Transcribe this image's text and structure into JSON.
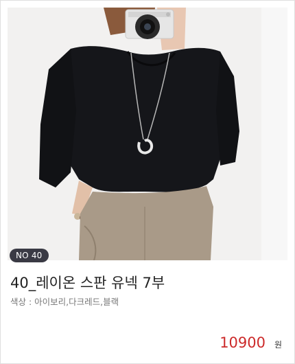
{
  "product": {
    "badge": "NO 40",
    "title": "40_레이온 스판 유넥 7부",
    "colors": "색상 : 아이보리,다크레드,블랙",
    "price": "10900",
    "currency": "원"
  },
  "photo": {
    "alt": "woman in black scoop-neck top with long pendant necklace holding a camera"
  },
  "colors_palette": {
    "badge_bg": "#3a3a44",
    "price": "#cc2a2a",
    "top": "#15161a",
    "pants": "#a99a88"
  }
}
